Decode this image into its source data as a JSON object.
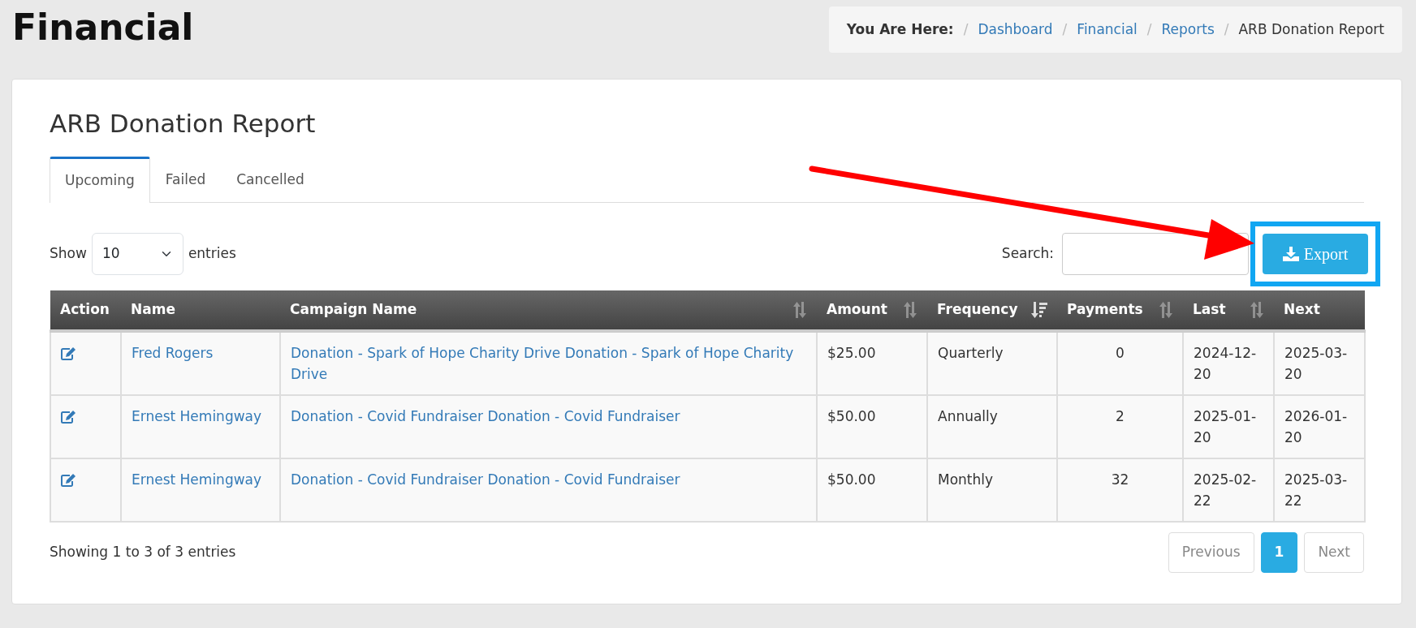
{
  "page_title": "Financial",
  "breadcrumb": {
    "label": "You Are Here:",
    "separator": "/",
    "items": [
      {
        "text": "Dashboard",
        "link": true
      },
      {
        "text": "Financial",
        "link": true
      },
      {
        "text": "Reports",
        "link": true
      },
      {
        "text": "ARB Donation Report",
        "link": false
      }
    ]
  },
  "report_title": "ARB Donation Report",
  "tabs": [
    {
      "label": "Upcoming",
      "selected": true
    },
    {
      "label": "Failed",
      "selected": false
    },
    {
      "label": "Cancelled",
      "selected": false
    }
  ],
  "length_control": {
    "before": "Show",
    "value": "10",
    "after": "entries"
  },
  "search": {
    "label": "Search:"
  },
  "export_button": {
    "label": "Export",
    "highlighted": true
  },
  "table": {
    "columns": [
      {
        "label": "Action",
        "sortable": false,
        "sorted": false
      },
      {
        "label": "Name",
        "sortable": false,
        "sorted": false
      },
      {
        "label": "Campaign Name",
        "sortable": true,
        "sorted": false
      },
      {
        "label": "Amount",
        "sortable": true,
        "sorted": false
      },
      {
        "label": "Frequency",
        "sortable": true,
        "sorted": true
      },
      {
        "label": "Payments",
        "sortable": true,
        "sorted": false
      },
      {
        "label": "Last",
        "sortable": true,
        "sorted": false
      },
      {
        "label": "Next",
        "sortable": false,
        "sorted": false
      }
    ],
    "rows": [
      {
        "name": "Fred Rogers",
        "campaign": "Donation - Spark of Hope Charity Drive Donation - Spark of Hope Charity Drive",
        "amount": "$25.00",
        "frequency": "Quarterly",
        "payments": "0",
        "last": "2024-12-20",
        "next": "2025-03-20"
      },
      {
        "name": "Ernest Hemingway",
        "campaign": "Donation - Covid Fundraiser Donation - Covid Fundraiser",
        "amount": "$50.00",
        "frequency": "Annually",
        "payments": "2",
        "last": "2025-01-20",
        "next": "2026-01-20"
      },
      {
        "name": "Ernest Hemingway",
        "campaign": "Donation - Covid Fundraiser Donation - Covid Fundraiser",
        "amount": "$50.00",
        "frequency": "Monthly",
        "payments": "32",
        "last": "2025-02-22",
        "next": "2025-03-22"
      }
    ]
  },
  "info": "Showing 1 to 3 of 3 entries",
  "pagination": [
    {
      "label": "Previous",
      "selected": false
    },
    {
      "label": "1",
      "selected": true
    },
    {
      "label": "Next",
      "selected": false
    }
  ]
}
